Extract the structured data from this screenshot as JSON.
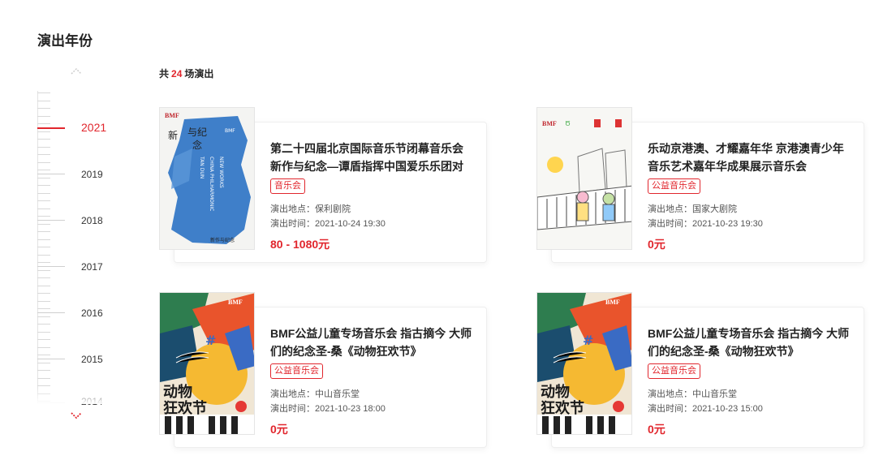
{
  "section_title": "演出年份",
  "timeline": {
    "years": [
      {
        "label": "2021",
        "active": true
      },
      {
        "label": "2019",
        "active": false
      },
      {
        "label": "2018",
        "active": false
      },
      {
        "label": "2017",
        "active": false
      },
      {
        "label": "2016",
        "active": false
      },
      {
        "label": "2015",
        "active": false
      },
      {
        "label": "2014",
        "active": false
      }
    ],
    "up_icon": "chevron-up-icon",
    "down_icon": "chevron-down-icon",
    "accent_color": "#e1262d"
  },
  "count": {
    "prefix": "共",
    "number": "24",
    "suffix": "场演出"
  },
  "cards": [
    {
      "title": "第二十四届北京国际音乐节闭幕音乐会 新作与纪念—谭盾指挥中国爱乐乐团对话…",
      "tag": "音乐会",
      "venue_label": "演出地点：",
      "venue": "保利剧院",
      "time_label": "演出时间：",
      "time": "2021-10-24 19:30",
      "price": "80 - 1080元",
      "poster": "blue-poster",
      "poster_text": "BMF",
      "poster_caption": "新作与纪念"
    },
    {
      "title": "乐动京港澳、才耀嘉年华 京港澳青少年音乐艺术嘉年华成果展示音乐会",
      "tag": "公益音乐会",
      "venue_label": "演出地点：",
      "venue": "国家大剧院",
      "time_label": "演出时间：",
      "time": "2021-10-23 19:30",
      "price": "0元",
      "poster": "sketch-poster",
      "poster_text": "BMF"
    },
    {
      "title": "BMF公益儿童专场音乐会 指古摘今 大师们的纪念圣-桑《动物狂欢节》",
      "tag": "公益音乐会",
      "venue_label": "演出地点：",
      "venue": "中山音乐堂",
      "time_label": "演出时间：",
      "time": "2021-10-23 18:00",
      "price": "0元",
      "poster": "animal-poster",
      "poster_text": "BMF",
      "poster_caption": "动物狂欢节"
    },
    {
      "title": "BMF公益儿童专场音乐会 指古摘今 大师们的纪念圣-桑《动物狂欢节》",
      "tag": "公益音乐会",
      "venue_label": "演出地点：",
      "venue": "中山音乐堂",
      "time_label": "演出时间：",
      "time": "2021-10-23 15:00",
      "price": "0元",
      "poster": "animal-poster",
      "poster_text": "BMF",
      "poster_caption": "动物狂欢节"
    }
  ]
}
